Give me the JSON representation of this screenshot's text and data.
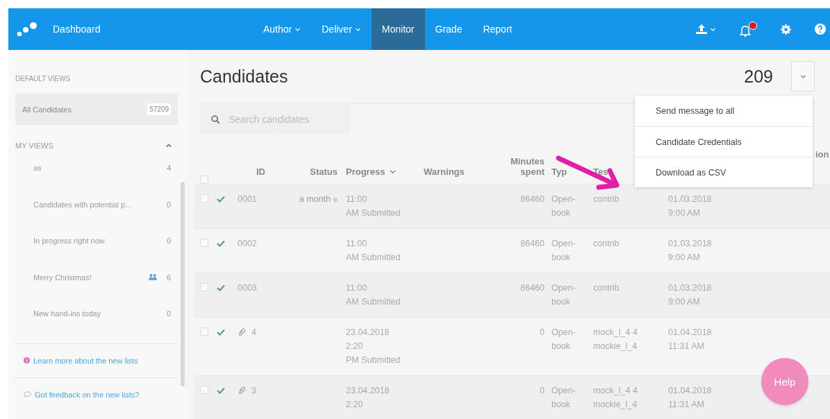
{
  "nav": {
    "logo_text": "Dashboard",
    "notifications_unread": true,
    "items": [
      {
        "label": "Author",
        "has_menu": true,
        "selected": false
      },
      {
        "label": "Deliver",
        "has_menu": true,
        "selected": false
      },
      {
        "label": "Monitor",
        "has_menu": false,
        "selected": true
      },
      {
        "label": "Grade",
        "has_menu": false,
        "selected": false
      },
      {
        "label": "Report",
        "has_menu": false,
        "selected": false
      }
    ]
  },
  "sidebar": {
    "default_heading": "DEFAULT VIEWS",
    "default_views": [
      {
        "label": "All Candidates",
        "count": "57209",
        "selected": true
      }
    ],
    "my_heading": "MY VIEWS",
    "my_expanded": true,
    "my_views": [
      {
        "label": "as",
        "count": "4",
        "shared": false,
        "selected": false
      },
      {
        "label": "Candidates with potential p...",
        "count": "0",
        "shared": false,
        "selected": false
      },
      {
        "label": "In progress right now",
        "count": "0",
        "shared": false,
        "selected": false
      },
      {
        "label": "Merry Christmas!",
        "count": "6",
        "shared": true,
        "selected": false
      },
      {
        "label": "New hand-ins today",
        "count": "0",
        "shared": false,
        "selected": false
      }
    ],
    "links": [
      {
        "kind": "info",
        "label": "Learn more about the new lists"
      },
      {
        "kind": "feedback",
        "label": "Got feedback on the new lists?"
      }
    ]
  },
  "main": {
    "title": "Candidates",
    "total": "209",
    "menu_open": true,
    "menu": [
      "Send message to all",
      "Candidate Credentials",
      "Download as CSV"
    ],
    "search": {
      "placeholder": "Search candidates"
    },
    "table": {
      "header_checked": false,
      "columns": [
        {
          "label": "ID",
          "sorted": false
        },
        {
          "label": "Status",
          "sorted": false
        },
        {
          "label": "Progress",
          "sorted": true
        },
        {
          "label": "Warnings",
          "sorted": false
        },
        {
          "label": "Minutes spent",
          "sorted": false
        },
        {
          "label": "Typ",
          "sorted": false
        },
        {
          "label": "Tes",
          "sorted": false
        },
        {
          "label": "ion",
          "sorted": false
        }
      ],
      "rows": [
        {
          "checked": false,
          "submitted": true,
          "attachment": false,
          "id": "0001",
          "status": "a month",
          "progress": "11:00\nAM Submitted",
          "minutes": "86460",
          "type": "Open-\nbook",
          "test": "contrib",
          "date": "01.03.2018\n9:00 AM"
        },
        {
          "checked": false,
          "submitted": true,
          "attachment": false,
          "id": "0002",
          "progress": "11:00\nAM Submitted",
          "minutes": "86460",
          "type": "Open-\nbook",
          "test": "contrib",
          "date": "01.03.2018\n9:00 AM"
        },
        {
          "checked": false,
          "submitted": true,
          "attachment": false,
          "id": "0003",
          "progress": "11:00\nAM Submitted",
          "minutes": "86460",
          "type": "Open-\nbook",
          "test": "contrib",
          "date": "01.03.2018\n9:00 AM"
        },
        {
          "checked": false,
          "submitted": true,
          "attachment": true,
          "id": "4",
          "progress": "23.04.2018\n2:20\nPM Submitted",
          "minutes": "0",
          "type": "Open-\nbook",
          "test": "mock_l_4 4\nmockie_l_4",
          "date": "01.04.2018\n11:31 AM"
        },
        {
          "checked": false,
          "submitted": true,
          "attachment": true,
          "id": "3",
          "progress": "23.04.2018\n2:20",
          "minutes": "0",
          "type": "Open-\nbook",
          "test": "mock_l_4 4\nmockie_l_4",
          "date": "01.04.2018\n11:31 AM"
        }
      ]
    }
  },
  "help_button": {
    "label": "Help"
  }
}
